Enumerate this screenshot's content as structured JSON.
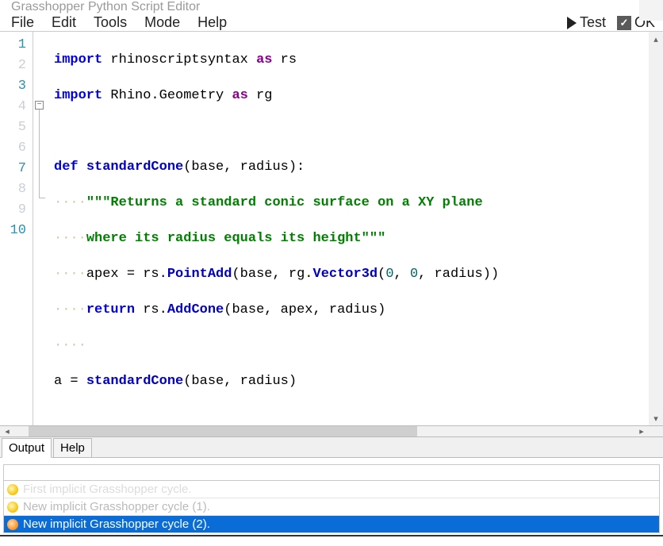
{
  "window": {
    "title": "Grasshopper Python Script Editor"
  },
  "menu": {
    "file": "File",
    "edit": "Edit",
    "tools": "Tools",
    "mode": "Mode",
    "help": "Help",
    "test": "Test",
    "ok": "OK"
  },
  "code": {
    "l1_a": "import",
    "l1_b": " rhinoscriptsyntax ",
    "l1_c": "as",
    "l1_d": " rs",
    "l2_a": "import",
    "l2_b": " Rhino.Geometry ",
    "l2_c": "as",
    "l2_d": " rg",
    "l4_a": "def",
    "l4_b": " ",
    "l4_c": "standardCone",
    "l4_d": "(base, radius):",
    "ind": "····",
    "l5_s": "\"\"\"Returns a standard conic surface on a XY plane",
    "l6_s": "where its radius equals its height\"\"\"",
    "l7_a": "apex = rs.",
    "l7_b": "PointAdd",
    "l7_c": "(base, rg.",
    "l7_d": "Vector3d",
    "l7_e": "(",
    "zero": "0",
    "l7_sep": ", ",
    "l7_f": ", radius))",
    "l8_a": "return",
    "l8_b": " rs.",
    "l8_c": "AddCone",
    "l8_d": "(base, apex, radius)",
    "l10_a": "a = ",
    "l10_b": "standardCone",
    "l10_c": "(base, radius)"
  },
  "line_numbers": {
    "n1": "1",
    "n2": "2",
    "n3": "3",
    "n4": "4",
    "n5": "5",
    "n6": "6",
    "n7": "7",
    "n8": "8",
    "n9": "9",
    "n10": "10"
  },
  "fold_symbol": "−",
  "tabs": {
    "output": "Output",
    "help": "Help"
  },
  "output": {
    "r1": "First implicit Grasshopper cycle.",
    "r2": "New implicit Grasshopper cycle (1).",
    "r3": "New implicit Grasshopper cycle (2)."
  }
}
